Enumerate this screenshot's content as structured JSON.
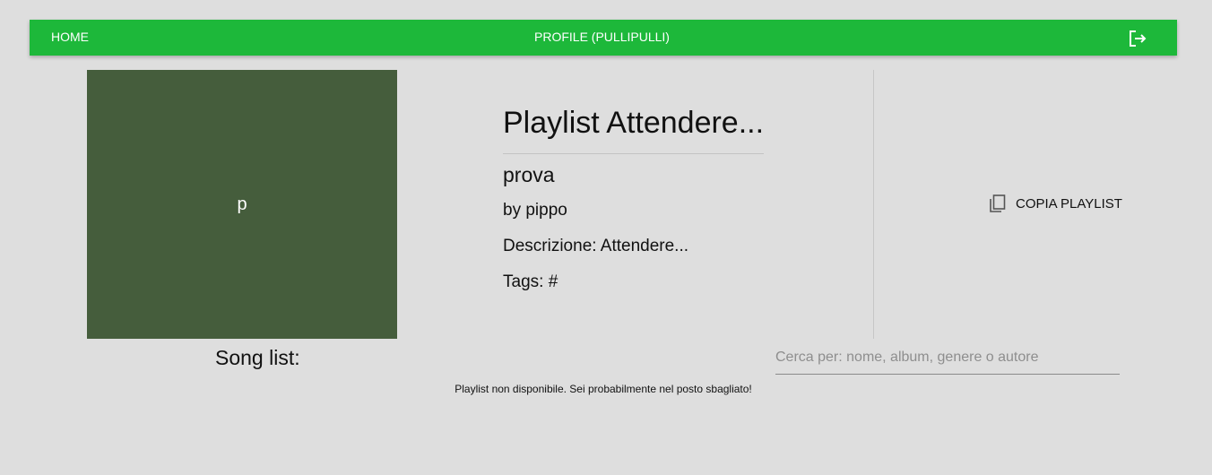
{
  "appbar": {
    "home_label": "HOME",
    "profile_label": "PROFILE (PULLIPULLI)",
    "logout_icon": "logout-icon",
    "color": "#1db83a"
  },
  "playlist": {
    "cover_letter": "p",
    "cover_color": "#455d3c",
    "title": "Playlist Attendere...",
    "name": "prova",
    "owner": "by pippo",
    "description": "Descrizione: Attendere...",
    "tags": "Tags: #"
  },
  "actions": {
    "copy_label": "COPIA PLAYLIST",
    "copy_icon": "copy-icon"
  },
  "songs": {
    "label": "Song list:",
    "search_placeholder": "Cerca per: nome, album, genere o autore",
    "search_value": "",
    "status_message": "Playlist non disponibile. Sei probabilmente nel posto sbagliato!"
  }
}
